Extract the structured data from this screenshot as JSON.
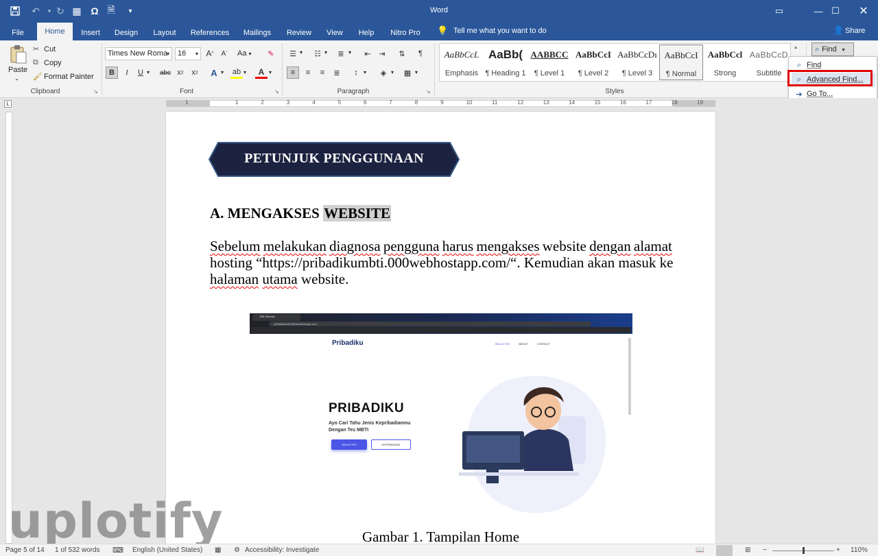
{
  "app": {
    "title": "Word"
  },
  "tabs": [
    "File",
    "Home",
    "Insert",
    "Design",
    "Layout",
    "References",
    "Mailings",
    "Review",
    "View",
    "Help",
    "Nitro Pro"
  ],
  "tell_me": "Tell me what you want to do",
  "share": "Share",
  "clipboard": {
    "paste": "Paste",
    "cut": "Cut",
    "copy": "Copy",
    "format_painter": "Format Painter",
    "label": "Clipboard"
  },
  "font": {
    "name": "Times New Roma",
    "size": "16",
    "label": "Font",
    "aa": "Aa"
  },
  "paragraph": {
    "label": "Paragraph"
  },
  "styles": {
    "label": "Styles",
    "items": [
      {
        "preview": "AaBbCcL",
        "name": "Emphasis"
      },
      {
        "preview": "AaBb(",
        "name": "¶ Heading 1"
      },
      {
        "preview": "AABBCC",
        "name": "¶ Level 1"
      },
      {
        "preview": "AaBbCcI",
        "name": "¶ Level 2"
      },
      {
        "preview": "AaBbCcDı",
        "name": "¶ Level 3"
      },
      {
        "preview": "AaBbCcI",
        "name": "¶ Normal"
      },
      {
        "preview": "AaBbCcl",
        "name": "Strong"
      },
      {
        "preview": "AaBbCcD",
        "name": "Subtitle"
      }
    ]
  },
  "find_menu": {
    "button": "Find",
    "items": [
      "Find",
      "Advanced Find...",
      "Go To..."
    ]
  },
  "ruler": {
    "numbers": [
      "1",
      "1",
      "2",
      "3",
      "4",
      "5",
      "6",
      "7",
      "8",
      "9",
      "10",
      "11",
      "12",
      "13",
      "14",
      "15",
      "16",
      "17",
      "18",
      "19"
    ]
  },
  "document": {
    "banner": "PETUNJUK PENGGUNAAN",
    "heading_prefix": "A. MENGAKSES",
    "heading_highlight": "WEBSITE",
    "para_line1": [
      "Sebelum",
      "melakukan",
      "diagnosa",
      "pengguna",
      "harus",
      "mengakses",
      "website",
      "dengan",
      "alamat"
    ],
    "para_line2": "hosting “https://pribadikumbti.000webhostapp.com/“. Kemudian akan masuk ke",
    "para_line3": [
      "halaman",
      "utama",
      "website."
    ],
    "caption_prefix": "Gambar 1.",
    "caption_word": "Tampilan",
    "caption_suffix": "Home"
  },
  "screenshot": {
    "brand": "Pribadiku",
    "nav": [
      "MULAI TES",
      "ABOUT",
      "CONTACT"
    ],
    "title": "PRIBADIKU",
    "subtitle_1": "Ayo Cari Tahu Jenis Kepribadianmu",
    "subtitle_2": "Dengan Tes MBTI",
    "btn_primary": "MULAI TES",
    "btn_secondary": "KEPRIBADIAN",
    "tab_title": "TAB Website",
    "url": "pribadikumbti.000webhostapp.com"
  },
  "watermark": "uplotify",
  "status": {
    "page": "Page 5 of 14",
    "words": "1 of 532 words",
    "language": "English (United States)",
    "accessibility": "Accessibility: Investigate",
    "zoom": "110%"
  },
  "colors": {
    "accent": "#2b579a",
    "highlight_box": "#e00000",
    "banner_bg": "#1c2340",
    "cta": "#4b55e6"
  }
}
